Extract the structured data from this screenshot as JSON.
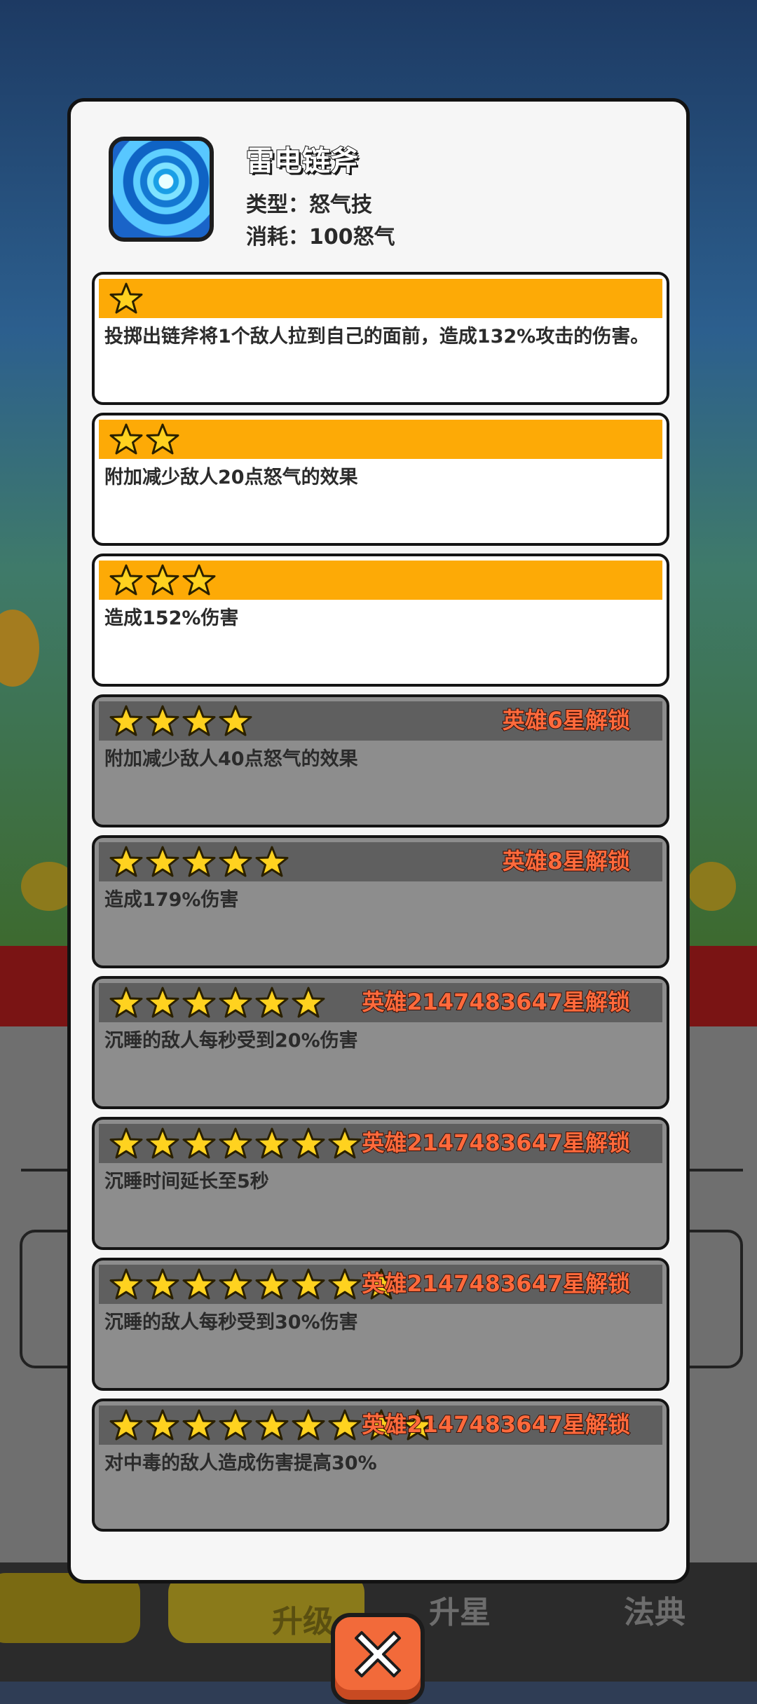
{
  "skill": {
    "name": "雷电链斧",
    "type_line": "类型：怒气技",
    "cost_line": "消耗：100怒气",
    "icon": "whirlpool-icon"
  },
  "levels": [
    {
      "stars": 1,
      "unlocked": true,
      "unlock_text": "",
      "desc": "投掷出链斧将1个敌人拉到自己的面前，造成132%攻击的伤害。"
    },
    {
      "stars": 2,
      "unlocked": true,
      "unlock_text": "",
      "desc": "附加减少敌人20点怒气的效果"
    },
    {
      "stars": 3,
      "unlocked": true,
      "unlock_text": "",
      "desc": "造成152%伤害"
    },
    {
      "stars": 4,
      "unlocked": false,
      "unlock_text": "英雄6星解锁",
      "desc": "附加减少敌人40点怒气的效果"
    },
    {
      "stars": 5,
      "unlocked": false,
      "unlock_text": "英雄8星解锁",
      "desc": "造成179%伤害"
    },
    {
      "stars": 6,
      "unlocked": false,
      "unlock_text": "英雄2147483647星解锁",
      "desc": "沉睡的敌人每秒受到20%伤害"
    },
    {
      "stars": 7,
      "unlocked": false,
      "unlock_text": "英雄2147483647星解锁",
      "desc": "沉睡时间延长至5秒"
    },
    {
      "stars": 8,
      "unlocked": false,
      "unlock_text": "英雄2147483647星解锁",
      "desc": "沉睡的敌人每秒受到30%伤害"
    },
    {
      "stars": 9,
      "unlocked": false,
      "unlock_text": "英雄2147483647星解锁",
      "desc": "对中毒的敌人造成伤害提高30%"
    }
  ],
  "background": {
    "tab_upgrade": "升级",
    "tab_star": "升星",
    "tab_codex": "法典"
  },
  "colors": {
    "bar_unlocked": "#fdaa06",
    "bar_locked": "#5f5f5f",
    "unlock_text": "#ff6a3c",
    "star": "#ffd21f"
  },
  "close_icon": "close-icon"
}
